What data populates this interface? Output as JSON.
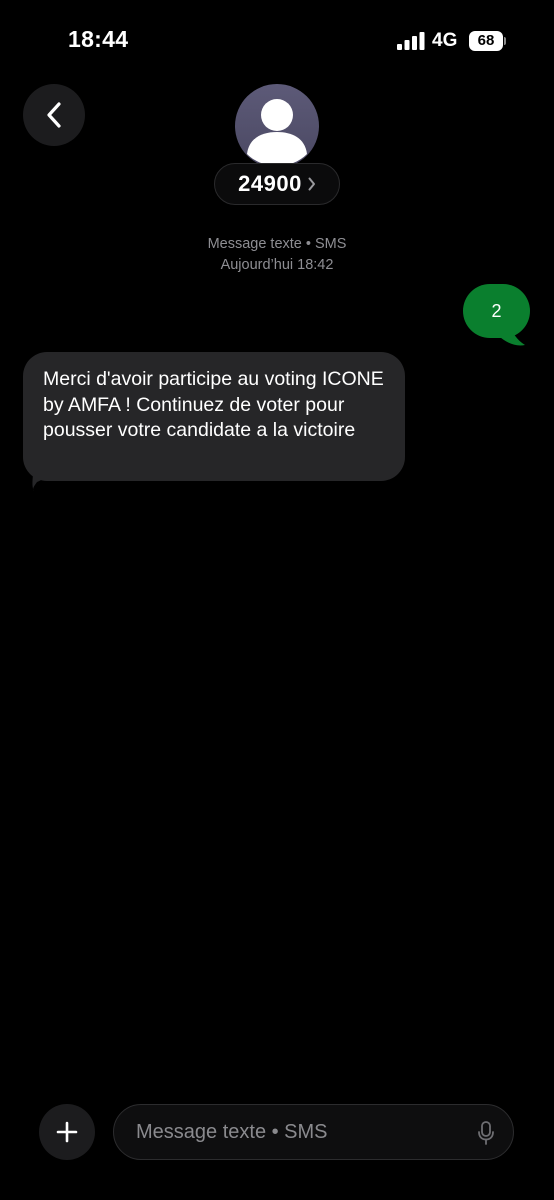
{
  "status_bar": {
    "time": "18:44",
    "network": "4G",
    "battery": "68"
  },
  "header": {
    "back_icon": "chevron-left-icon",
    "avatar_icon": "person-icon",
    "contact_name": "24900",
    "contact_chevron_icon": "chevron-right-icon"
  },
  "conversation": {
    "meta_type": "Message texte • SMS",
    "meta_time": "Aujourd’hui 18:42",
    "messages": [
      {
        "direction": "sent",
        "text": "2"
      },
      {
        "direction": "received",
        "text": "Merci d'avoir participe au voting ICONE by AMFA ! Continuez de voter pour pousser votre candidate a la victoire"
      }
    ]
  },
  "composer": {
    "add_icon": "plus-icon",
    "placeholder": "Message texte • SMS",
    "mic_icon": "microphone-icon"
  },
  "colors": {
    "background": "#000000",
    "sent_bubble": "#0a7f2e",
    "received_bubble": "#262628",
    "secondary_text": "#8e8e93"
  }
}
